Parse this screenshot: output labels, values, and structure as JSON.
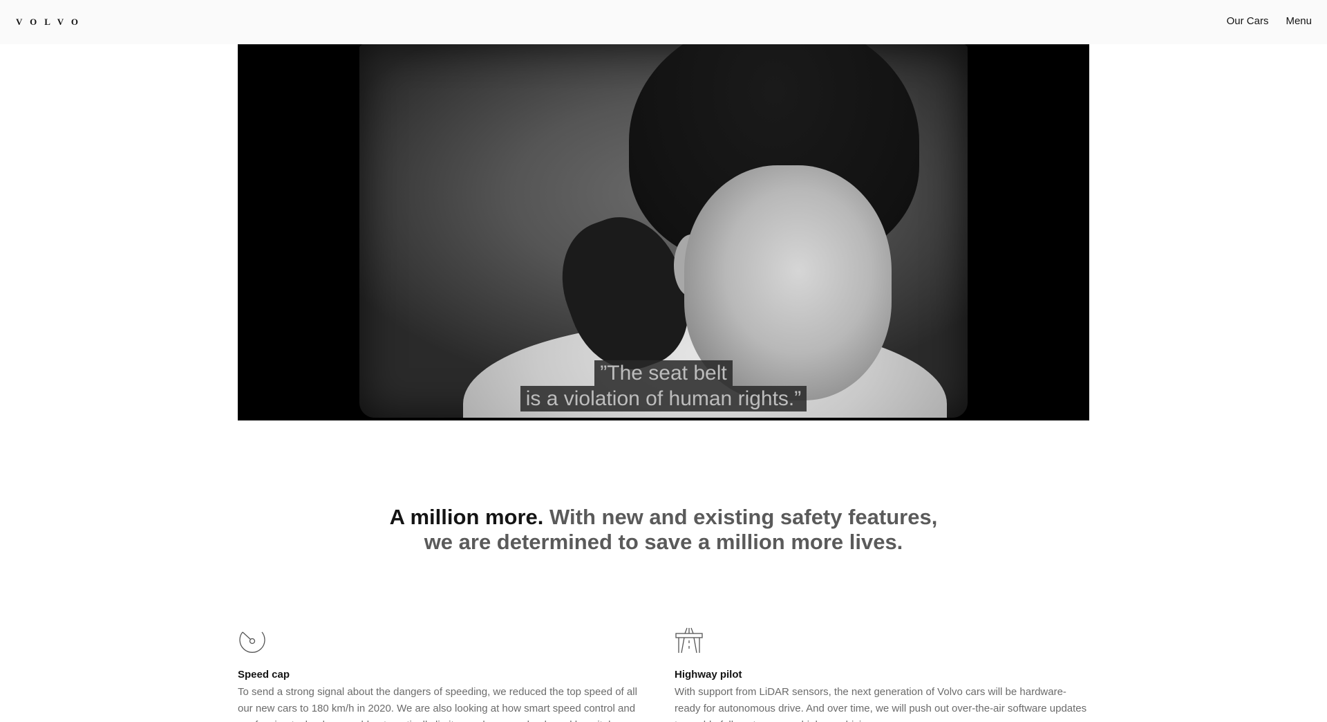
{
  "header": {
    "logo": "VOLVO",
    "nav": [
      {
        "label": "Our Cars"
      },
      {
        "label": "Menu"
      }
    ]
  },
  "video": {
    "subtitle_line1": "”The seat belt",
    "subtitle_line2": "is a violation of human rights.”"
  },
  "intro": {
    "lead": "A million more.",
    "text": " With new and existing safety features, we are determined to save a million more lives."
  },
  "features": [
    {
      "icon": "speedometer-icon",
      "title": "Speed cap",
      "text": "To send a strong signal about the dangers of speeding, we reduced the top speed of all our new cars to 180 km/h in 2020. We are also looking at how smart speed control and geofencing technology could automatically limit speeds near schools and hospitals."
    },
    {
      "icon": "highway-icon",
      "title": "Highway pilot",
      "text": "With support from LiDAR sensors, the next generation of Volvo cars will be hardware-ready for autonomous drive. And over time, we will push out over-the-air software updates to enable fully autonomous highway driving."
    }
  ]
}
